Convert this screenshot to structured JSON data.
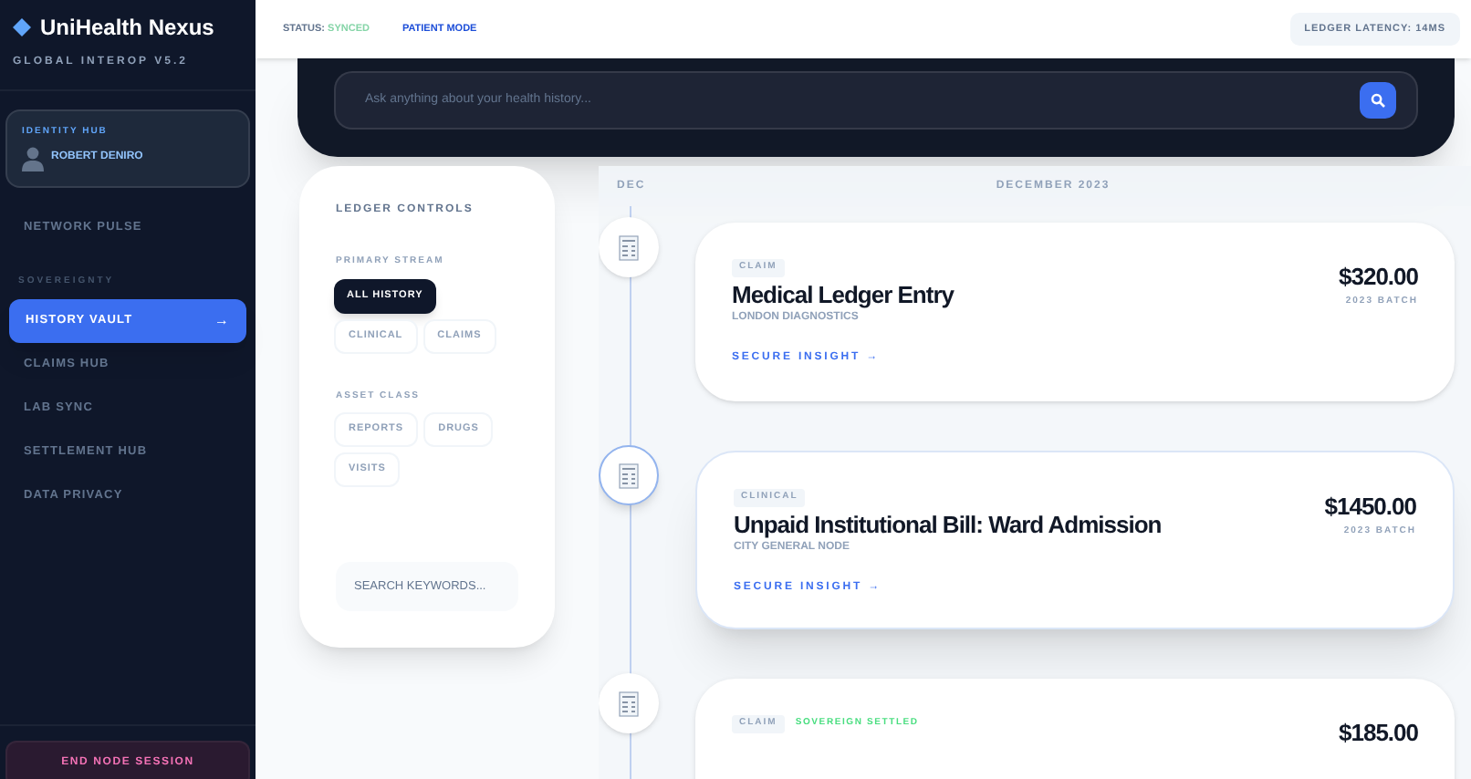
{
  "brand": {
    "title": "UniHealth Nexus",
    "subtitle": "GLOBAL INTEROP V5.2"
  },
  "identity": {
    "label": "IDENTITY HUB",
    "name": "ROBERT DENIRO"
  },
  "nav": [
    {
      "kind": "item",
      "label": "NETWORK PULSE",
      "selected": false
    },
    {
      "kind": "section",
      "label": "SOVEREIGNTY"
    },
    {
      "kind": "item",
      "label": "HISTORY VAULT",
      "selected": true,
      "arrow": "→"
    },
    {
      "kind": "item",
      "label": "CLAIMS HUB",
      "selected": false
    },
    {
      "kind": "item",
      "label": "LAB SYNC",
      "selected": false
    },
    {
      "kind": "item",
      "label": "SETTLEMENT HUB",
      "selected": false
    },
    {
      "kind": "item",
      "label": "DATA PRIVACY",
      "selected": false
    }
  ],
  "end_session": "END NODE SESSION",
  "header": {
    "status_label": "STATUS:",
    "status_value": "SYNCED",
    "mode": "PATIENT MODE",
    "latency": "LEDGER LATENCY: 14MS"
  },
  "search": {
    "placeholder": "Ask anything about your health history..."
  },
  "controls": {
    "title": "LEDGER CONTROLS",
    "groups": [
      {
        "label": "PRIMARY STREAM",
        "chips": [
          {
            "label": "ALL HISTORY",
            "selected": true
          },
          {
            "label": "CLINICAL",
            "selected": false
          },
          {
            "label": "CLAIMS",
            "selected": false
          }
        ]
      },
      {
        "label": "ASSET CLASS",
        "chips": [
          {
            "label": "REPORTS",
            "selected": false
          },
          {
            "label": "DRUGS",
            "selected": false
          },
          {
            "label": "VISITS",
            "selected": false
          }
        ]
      }
    ],
    "keyword_placeholder": "SEARCH KEYWORDS..."
  },
  "timeline": {
    "month_short": "DEC",
    "month": "DECEMBER 2023",
    "entries": [
      {
        "tag": "CLAIM",
        "title": "Medical Ledger Entry",
        "source": "LONDON DIAGNOSTICS",
        "amount": "$320.00",
        "batch": "2023 BATCH",
        "link": "SECURE INSIGHT →",
        "selected": false
      },
      {
        "tag": "CLINICAL",
        "title": "Unpaid Institutional Bill: Ward Admission",
        "source": "CITY GENERAL NODE",
        "amount": "$1450.00",
        "batch": "2023 BATCH",
        "link": "SECURE INSIGHT →",
        "selected": true
      },
      {
        "tag": "CLAIM",
        "status": "SOVEREIGN SETTLED",
        "amount": "$185.00",
        "selected": false
      }
    ]
  }
}
